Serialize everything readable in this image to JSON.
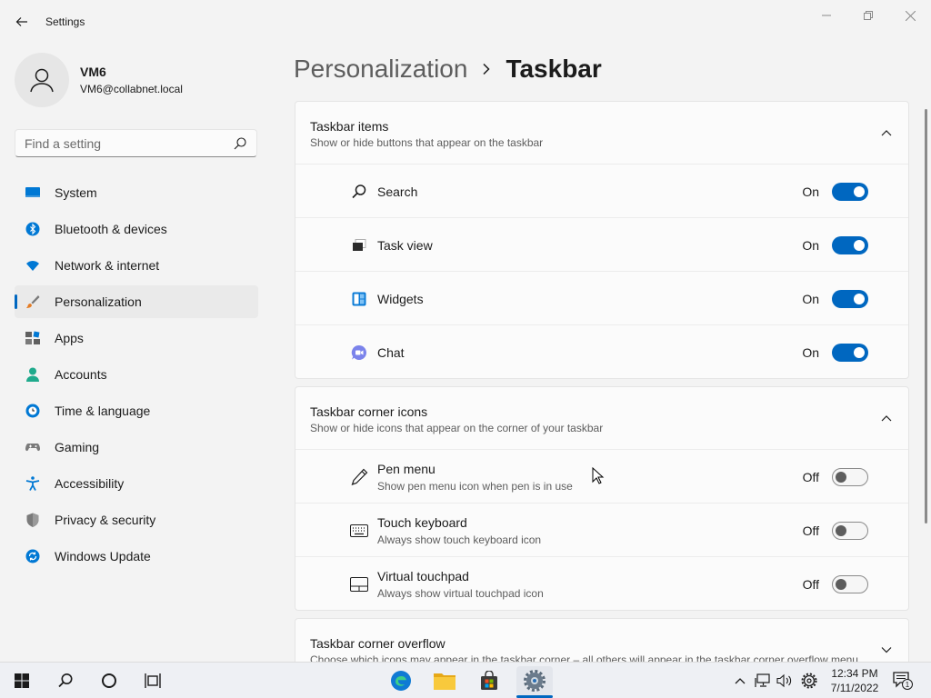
{
  "window": {
    "title": "Settings"
  },
  "profile": {
    "name": "VM6",
    "email": "VM6@collabnet.local"
  },
  "search": {
    "placeholder": "Find a setting"
  },
  "nav": [
    {
      "label": "System",
      "icon": "system-icon",
      "color": "#0078d4"
    },
    {
      "label": "Bluetooth & devices",
      "icon": "bluetooth-icon",
      "color": "#0078d4"
    },
    {
      "label": "Network & internet",
      "icon": "wifi-icon",
      "color": "#0078d4"
    },
    {
      "label": "Personalization",
      "icon": "paintbrush-icon",
      "color": "#e57c23",
      "active": true
    },
    {
      "label": "Apps",
      "icon": "apps-icon",
      "color": "#606060"
    },
    {
      "label": "Accounts",
      "icon": "accounts-icon",
      "color": "#1faa8c"
    },
    {
      "label": "Time & language",
      "icon": "clock-globe-icon",
      "color": "#0078d4"
    },
    {
      "label": "Gaming",
      "icon": "gamepad-icon",
      "color": "#7a7a7a"
    },
    {
      "label": "Accessibility",
      "icon": "accessibility-icon",
      "color": "#0078d4"
    },
    {
      "label": "Privacy & security",
      "icon": "shield-icon",
      "color": "#7a7a7a"
    },
    {
      "label": "Windows Update",
      "icon": "update-icon",
      "color": "#0078d4"
    }
  ],
  "breadcrumb": {
    "parent": "Personalization",
    "separator": "›",
    "current": "Taskbar"
  },
  "sections": {
    "items": {
      "title": "Taskbar items",
      "subtitle": "Show or hide buttons that appear on the taskbar",
      "rows": [
        {
          "label": "Search",
          "state": "On",
          "icon": "search-icon"
        },
        {
          "label": "Task view",
          "state": "On",
          "icon": "task-view-icon"
        },
        {
          "label": "Widgets",
          "state": "On",
          "icon": "widgets-icon"
        },
        {
          "label": "Chat",
          "state": "On",
          "icon": "chat-icon"
        }
      ]
    },
    "corner": {
      "title": "Taskbar corner icons",
      "subtitle": "Show or hide icons that appear on the corner of your taskbar",
      "rows": [
        {
          "label": "Pen menu",
          "desc": "Show pen menu icon when pen is in use",
          "state": "Off",
          "icon": "pen-icon"
        },
        {
          "label": "Touch keyboard",
          "desc": "Always show touch keyboard icon",
          "state": "Off",
          "icon": "keyboard-icon"
        },
        {
          "label": "Virtual touchpad",
          "desc": "Always show virtual touchpad icon",
          "state": "Off",
          "icon": "touchpad-icon"
        }
      ]
    },
    "overflow": {
      "title": "Taskbar corner overflow",
      "subtitle": "Choose which icons may appear in the taskbar corner – all others will appear in the taskbar corner overflow menu"
    }
  },
  "taskbar": {
    "clock_time": "12:34 PM",
    "clock_date": "7/11/2022",
    "notification_count": "1",
    "accent": "#0067c0"
  }
}
